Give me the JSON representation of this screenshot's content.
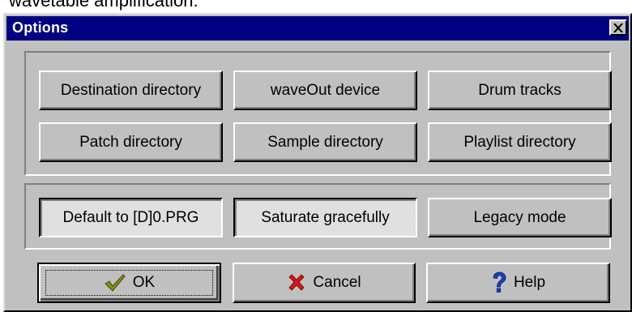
{
  "document": {
    "text_above": "wavetable amplification."
  },
  "window": {
    "title": "Options",
    "close_glyph": "✕"
  },
  "directories": {
    "buttons": [
      {
        "label": "Destination directory"
      },
      {
        "label": "waveOut device"
      },
      {
        "label": "Drum tracks"
      },
      {
        "label": "Patch directory"
      },
      {
        "label": "Sample directory"
      },
      {
        "label": "Playlist directory"
      }
    ]
  },
  "toggles": {
    "buttons": [
      {
        "label": "Default to [D]0.PRG",
        "pressed": true
      },
      {
        "label": "Saturate gracefully",
        "pressed": true
      },
      {
        "label": "Legacy mode",
        "pressed": false
      }
    ]
  },
  "actions": {
    "ok_label": "OK",
    "cancel_label": "Cancel",
    "help_label": "Help",
    "ok_icon": "checkmark-icon",
    "cancel_icon": "x-cross-icon",
    "help_icon": "question-mark-icon"
  },
  "colors": {
    "face": "#c0c0c0",
    "titlebar": "#000080",
    "checkmark": "#8a8a1e",
    "cross": "#d01818",
    "question": "#1840c8"
  }
}
